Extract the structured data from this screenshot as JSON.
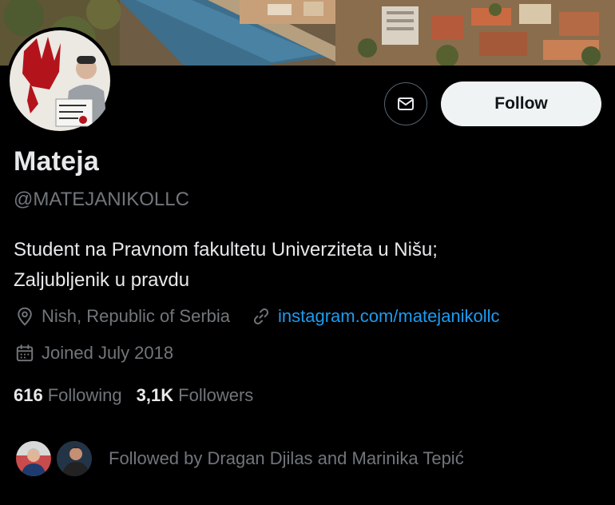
{
  "profile": {
    "name": "Mateja",
    "handle": "@MATEJANIKOLLC",
    "bio_line1": "Student na Pravnom fakultetu Univerziteta u Nišu;",
    "bio_line2": "Zaljubljenik u pravdu",
    "location": "Nish, Republic of Serbia",
    "website": "instagram.com/matejanikollc",
    "joined": "Joined July 2018"
  },
  "actions": {
    "message_icon": "mail-icon",
    "follow_label": "Follow"
  },
  "stats": {
    "following_count": "616",
    "following_label": "Following",
    "followers_count": "3,1K",
    "followers_label": "Followers"
  },
  "followed_by": {
    "text": "Followed by Dragan Djilas and Marinika Tepić"
  },
  "icons": {
    "location": "location-pin-icon",
    "link": "link-icon",
    "calendar": "calendar-icon"
  },
  "colors": {
    "background": "#000000",
    "primary_text": "#e7e9ea",
    "secondary_text": "#71767b",
    "link": "#1d9bf0",
    "follow_button_bg": "#eff3f4",
    "follow_button_text": "#0f1419"
  }
}
